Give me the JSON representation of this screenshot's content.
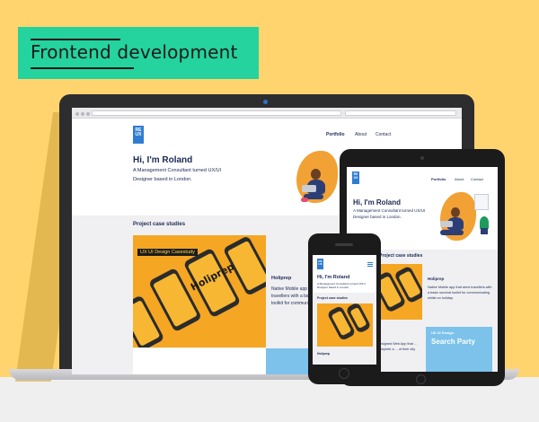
{
  "banner": {
    "label": "Frontend development"
  },
  "site": {
    "logo": "RE UX",
    "nav": [
      "Portfolio",
      "About",
      "Contact"
    ],
    "hero_title": "Hi, I'm Roland",
    "hero_subtitle": "A Management Consultant turned UX/UI Designer based in London.",
    "section_title": "Project case studies",
    "case_tag": "UX UI Design Casestudy",
    "brand_word": "Holiprep",
    "project_name": "Holiprep",
    "project_desc": "Native Mobile app that arms travellers with a basic survival toolkit for communicating whilst on holiday.",
    "second_tag": "UX UI Design",
    "second_title": "Search Party",
    "second_desc": "Designed Web App that ... complete a ... of their city"
  },
  "colors": {
    "background": "#ffd46e",
    "banner": "#24d39d",
    "brand_blue": "#2f7dd3",
    "navy": "#1c2a55",
    "orange": "#f5a623"
  }
}
